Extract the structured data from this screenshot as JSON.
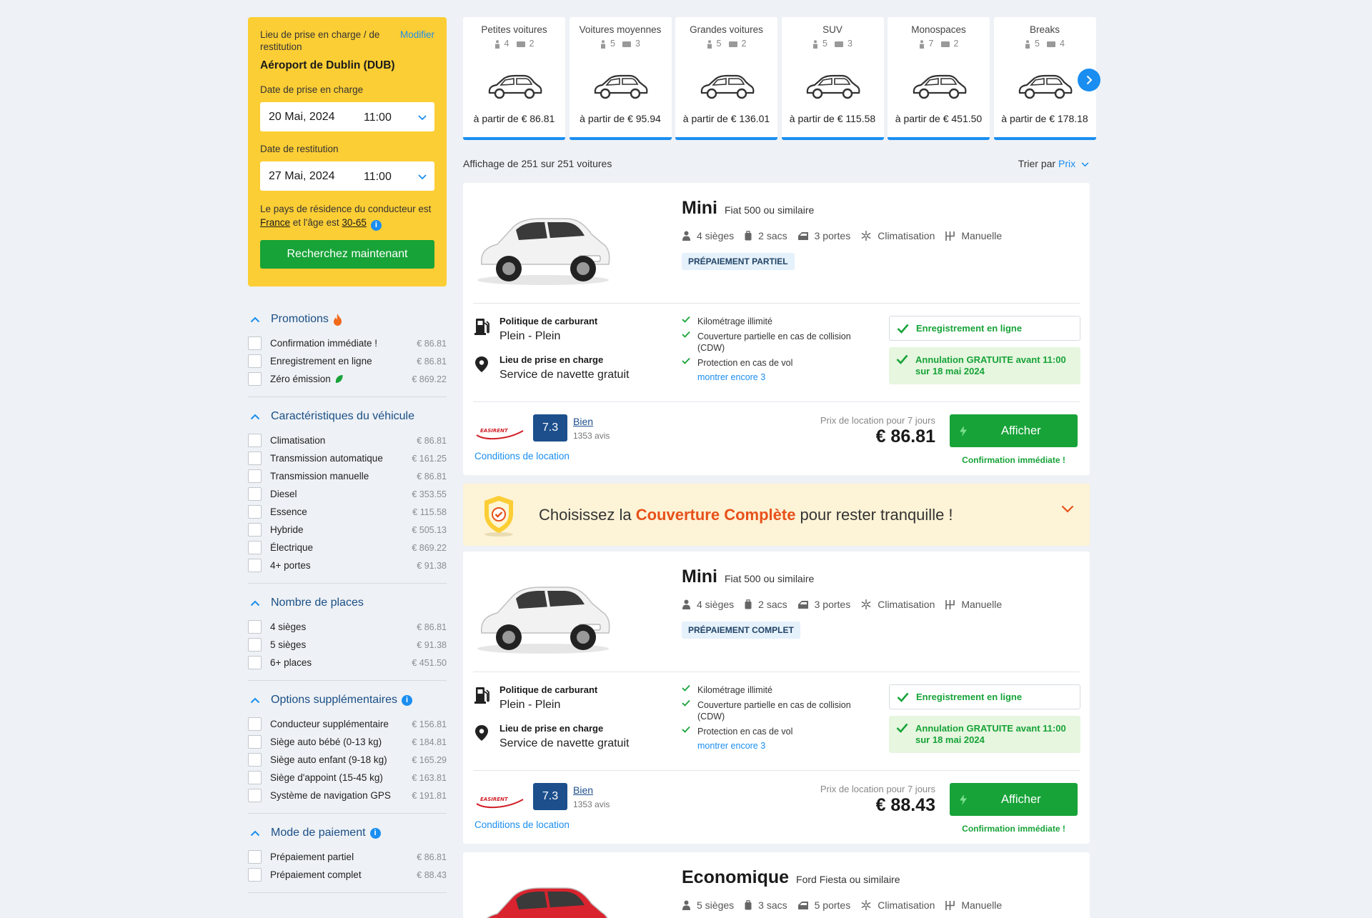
{
  "search": {
    "location_label": "Lieu de prise en charge / de restitution",
    "modify_label": "Modifier",
    "location": "Aéroport de Dublin (DUB)",
    "pickup_label": "Date de prise en charge",
    "pickup_date": "20 Mai, 2024",
    "pickup_time": "11:00",
    "return_label": "Date de restitution",
    "return_date": "27 Mai, 2024",
    "return_time": "11:00",
    "residence_prefix": "Le pays de résidence du conducteur est ",
    "residence_country": "France",
    "residence_mid": " et l'âge est ",
    "residence_age": "30-65",
    "search_button": "Recherchez maintenant"
  },
  "filters": [
    {
      "title": "Promotions",
      "items": [
        {
          "label": "Confirmation immédiate !",
          "price": "€ 86.81"
        },
        {
          "label": "Enregistrement en ligne",
          "price": "€ 86.81"
        },
        {
          "label": "Zéro émission",
          "price": "€ 869.22"
        }
      ]
    },
    {
      "title": "Caractéristiques du véhicule",
      "items": [
        {
          "label": "Climatisation",
          "price": "€ 86.81"
        },
        {
          "label": "Transmission automatique",
          "price": "€ 161.25"
        },
        {
          "label": "Transmission manuelle",
          "price": "€ 86.81"
        },
        {
          "label": "Diesel",
          "price": "€ 353.55"
        },
        {
          "label": "Essence",
          "price": "€ 115.58"
        },
        {
          "label": "Hybride",
          "price": "€ 505.13"
        },
        {
          "label": "Électrique",
          "price": "€ 869.22"
        },
        {
          "label": "4+ portes",
          "price": "€ 91.38"
        }
      ]
    },
    {
      "title": "Nombre de places",
      "items": [
        {
          "label": "4 sièges",
          "price": "€ 86.81"
        },
        {
          "label": "5 sièges",
          "price": "€ 91.38"
        },
        {
          "label": "6+ places",
          "price": "€ 451.50"
        }
      ]
    },
    {
      "title": "Options supplémentaires",
      "items": [
        {
          "label": "Conducteur supplémentaire",
          "price": "€ 156.81"
        },
        {
          "label": "Siège auto bébé (0-13 kg)",
          "price": "€ 184.81"
        },
        {
          "label": "Siège auto enfant (9-18 kg)",
          "price": "€ 165.29"
        },
        {
          "label": "Siège d'appoint (15-45 kg)",
          "price": "€ 163.81"
        },
        {
          "label": "Système de navigation GPS",
          "price": "€ 191.81"
        }
      ]
    },
    {
      "title": "Mode de paiement",
      "items": [
        {
          "label": "Prépaiement partiel",
          "price": "€ 86.81"
        },
        {
          "label": "Prépaiement complet",
          "price": "€ 88.43"
        }
      ]
    }
  ],
  "categories": [
    {
      "name": "Petites voitures",
      "seats": "4",
      "bags": "2",
      "from": "à partir de € 86.81"
    },
    {
      "name": "Voitures moyennes",
      "seats": "5",
      "bags": "3",
      "from": "à partir de € 95.94"
    },
    {
      "name": "Grandes voitures",
      "seats": "5",
      "bags": "2",
      "from": "à partir de € 136.01"
    },
    {
      "name": "SUV",
      "seats": "5",
      "bags": "3",
      "from": "à partir de € 115.58"
    },
    {
      "name": "Monospaces",
      "seats": "7",
      "bags": "2",
      "from": "à partir de € 451.50"
    },
    {
      "name": "Breaks",
      "seats": "5",
      "bags": "4",
      "from": "à partir de € 178.18"
    }
  ],
  "results": {
    "count_text": "Affichage de 251 sur 251 voitures",
    "sort_label": "Trier par",
    "sort_value": "Prix"
  },
  "cards": [
    {
      "class": "Mini",
      "similar": "Fiat 500 ou similaire",
      "seats": "4 sièges",
      "bags": "2 sacs",
      "doors": "3 portes",
      "ac": "Climatisation",
      "gearbox": "Manuelle",
      "badge": "PRÉPAIEMENT PARTIEL",
      "fuel_label": "Politique de carburant",
      "fuel_value": "Plein - Plein",
      "pickup_label": "Lieu de prise en charge",
      "pickup_value": "Service de navette gratuit",
      "inclusions": [
        "Kilométrage illimité",
        "Couverture partielle en cas de collision (CDW)",
        "Protection en cas de vol"
      ],
      "more": "montrer encore 3",
      "online_checkin": "Enregistrement en ligne",
      "free_cancel": "Annulation GRATUITE avant 11:00 sur 18 mai 2024",
      "score": "7.3",
      "rating": "Bien",
      "reviews": "1353 avis",
      "conditions": "Conditions de location",
      "price_label": "Prix de location pour 7 jours",
      "price": "€ 86.81",
      "cta": "Afficher",
      "confirm": "Confirmation immédiate !",
      "car_color": "#f2f2f2"
    },
    {
      "class": "Mini",
      "similar": "Fiat 500 ou similaire",
      "seats": "4 sièges",
      "bags": "2 sacs",
      "doors": "3 portes",
      "ac": "Climatisation",
      "gearbox": "Manuelle",
      "badge": "PRÉPAIEMENT COMPLET",
      "fuel_label": "Politique de carburant",
      "fuel_value": "Plein - Plein",
      "pickup_label": "Lieu de prise en charge",
      "pickup_value": "Service de navette gratuit",
      "inclusions": [
        "Kilométrage illimité",
        "Couverture partielle en cas de collision (CDW)",
        "Protection en cas de vol"
      ],
      "more": "montrer encore 3",
      "online_checkin": "Enregistrement en ligne",
      "free_cancel": "Annulation GRATUITE avant 11:00 sur 18 mai 2024",
      "score": "7.3",
      "rating": "Bien",
      "reviews": "1353 avis",
      "conditions": "Conditions de location",
      "price_label": "Prix de location pour 7 jours",
      "price": "€ 88.43",
      "cta": "Afficher",
      "confirm": "Confirmation immédiate !",
      "car_color": "#f2f2f2"
    },
    {
      "class": "Economique",
      "similar": "Ford Fiesta ou similaire",
      "seats": "5 sièges",
      "bags": "3 sacs",
      "doors": "5 portes",
      "ac": "Climatisation",
      "gearbox": "Manuelle",
      "car_color": "#d9232e"
    }
  ],
  "banner": {
    "prefix": "Choisissez la ",
    "highlight": "Couverture Complète",
    "suffix": " pour rester tranquille !"
  },
  "colors": {
    "accent": "#1a8ef0",
    "green": "#17a338",
    "yellow": "#fcce35",
    "navy": "#1c4f8c",
    "orange": "#e8511a"
  },
  "supplier_logo_text": "EASIRENT"
}
